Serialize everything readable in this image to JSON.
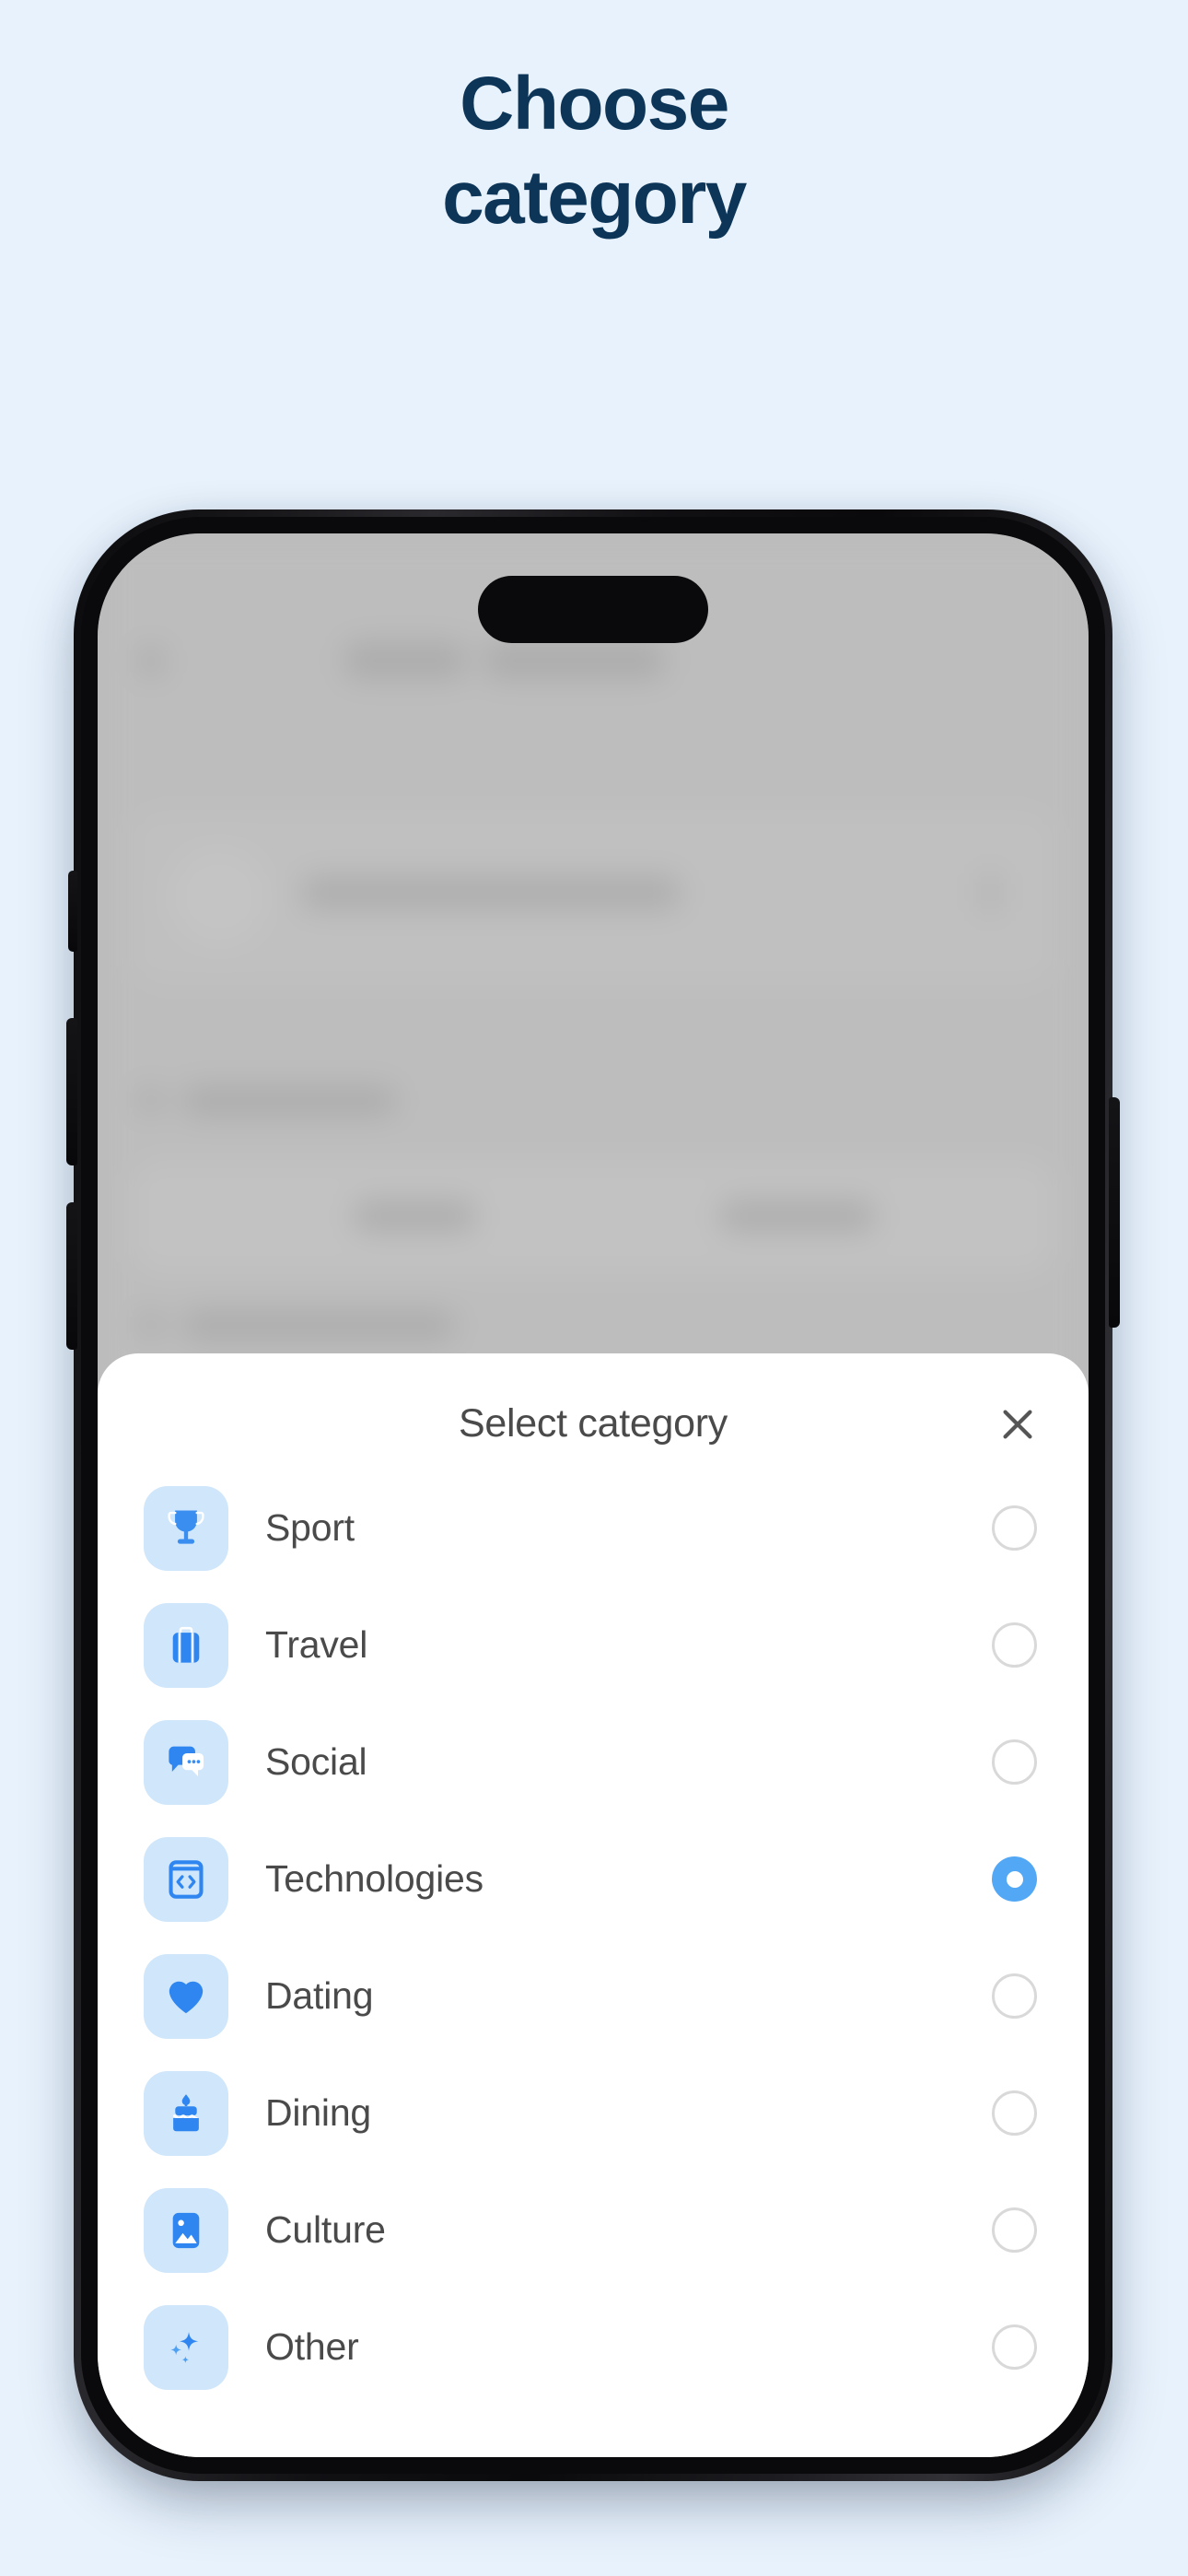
{
  "page": {
    "background_color": "#e7f2fd",
    "headline_color": "#0d3558",
    "accent_color": "#53a8f5",
    "icon_tile_color": "#cfe6fb"
  },
  "headline": {
    "line1": "Choose",
    "line2": "category"
  },
  "device": {
    "frame_color": "#0a0a0c",
    "buttons": {
      "silent_switch": "silent-switch",
      "volume_up": "volume-up-button",
      "volume_down": "volume-down-button",
      "power": "power-button"
    },
    "dynamic_island": "dynamic-island"
  },
  "sheet": {
    "title": "Select category",
    "close_label": "×",
    "close_icon": "close-icon"
  },
  "categories": [
    {
      "label": "Sport",
      "icon": "trophy-icon",
      "selected": false
    },
    {
      "label": "Travel",
      "icon": "suitcase-icon",
      "selected": false
    },
    {
      "label": "Social",
      "icon": "chat-icon",
      "selected": false
    },
    {
      "label": "Technologies",
      "icon": "code-icon",
      "selected": true
    },
    {
      "label": "Dating",
      "icon": "heart-icon",
      "selected": false
    },
    {
      "label": "Dining",
      "icon": "cake-icon",
      "selected": false
    },
    {
      "label": "Culture",
      "icon": "image-icon",
      "selected": false
    },
    {
      "label": "Other",
      "icon": "sparkles-icon",
      "selected": false
    }
  ]
}
